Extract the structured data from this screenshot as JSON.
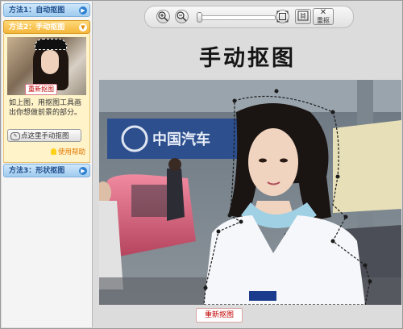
{
  "sidebar": {
    "method1_label": "方法1：自动抠图",
    "method2_label": "方法2：手动抠图",
    "method3_label": "方法3：形状抠图",
    "thumb_redo_label": "重新抠图",
    "description": "如上图，用抠图工具画出你想做前景的部分。",
    "manual_button_label": "点这里手动抠图",
    "help_label": "使用帮助"
  },
  "toolbar": {
    "zoom_in": "+",
    "zoom_out": "−",
    "zoom_level": 0,
    "redo_label": "重抠"
  },
  "main": {
    "title": "手动抠图",
    "photo_sign_text": "中国汽车",
    "redo_button_label": "重新抠图"
  },
  "colors": {
    "accent_orange": "#f4b63a",
    "accent_blue": "#9fcbee",
    "redo_red": "#c00000"
  }
}
